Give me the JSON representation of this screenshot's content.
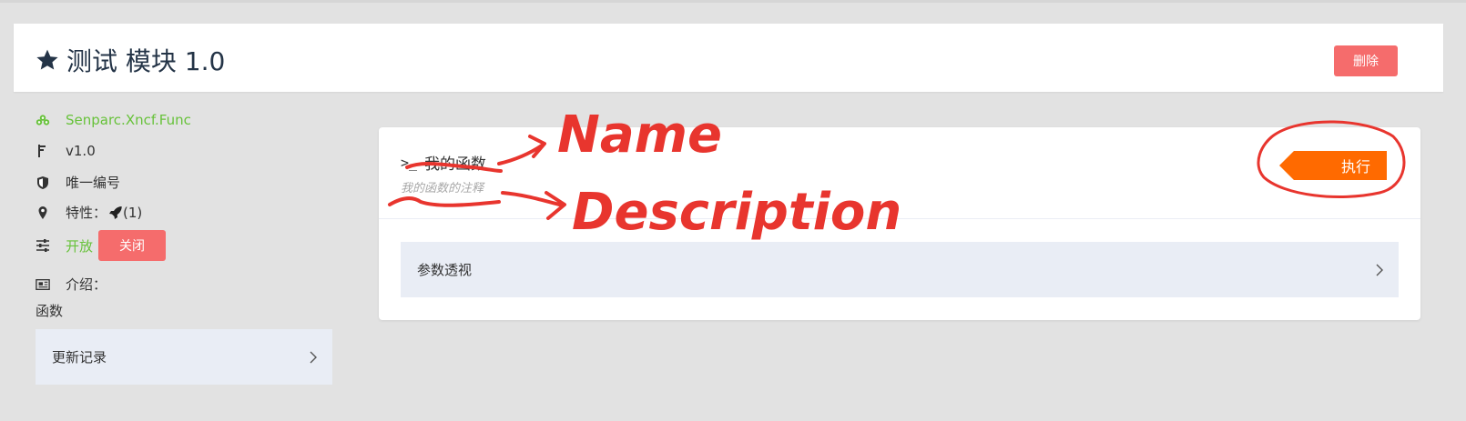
{
  "header": {
    "title": "测试 模块 1.0",
    "delete_label": "删除"
  },
  "sidebar": {
    "link_text": "Senparc.Xncf.Func",
    "version": "v1.0",
    "unique_id_label": "唯一编号",
    "features_label": "特性：",
    "features_count": "(1)",
    "open_label": "开放",
    "close_label": "关闭",
    "intro_label": "介绍：",
    "intro_text": "函数",
    "changelog_label": "更新记录"
  },
  "function": {
    "name": "我的函数",
    "description": "我的函数的注释",
    "execute_label": "执行",
    "params_label": "参数透视"
  },
  "annotations": {
    "name_label": "Name",
    "description_label": "Description"
  },
  "colors": {
    "background": "#e2e2e2",
    "danger": "#f56c6c",
    "success": "#67c23a",
    "execute": "#ff6a00",
    "annotation_red": "#e8352e",
    "collapse_bg": "#e9edf5"
  }
}
